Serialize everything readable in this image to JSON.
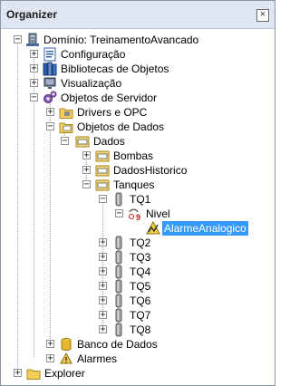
{
  "panel": {
    "title": "Organizer",
    "close": "×"
  },
  "tree": {
    "root": "Domínio: TreinamentoAvancado",
    "configuracao": "Configuração",
    "bibliotecas": "Bibliotecas de Objetos",
    "visualizacao": "Visualização",
    "servidor": "Objetos de Servidor",
    "drivers": "Drivers e OPC",
    "dados_obj": "Objetos de Dados",
    "dados": "Dados",
    "bombas": "Bombas",
    "dadoshist": "DadosHistorico",
    "tanques": "Tanques",
    "tq1": "TQ1",
    "nivel": "Nivel",
    "alarme_analogico": "AlarmeAnalogico",
    "tq2": "TQ2",
    "tq3": "TQ3",
    "tq4": "TQ4",
    "tq5": "TQ5",
    "tq6": "TQ6",
    "tq7": "TQ7",
    "tq8": "TQ8",
    "banco": "Banco de Dados",
    "alarmes": "Alarmes",
    "explorer": "Explorer"
  },
  "colors": {
    "selection": "#3399ff",
    "titlebar": "#dfe6f1"
  }
}
